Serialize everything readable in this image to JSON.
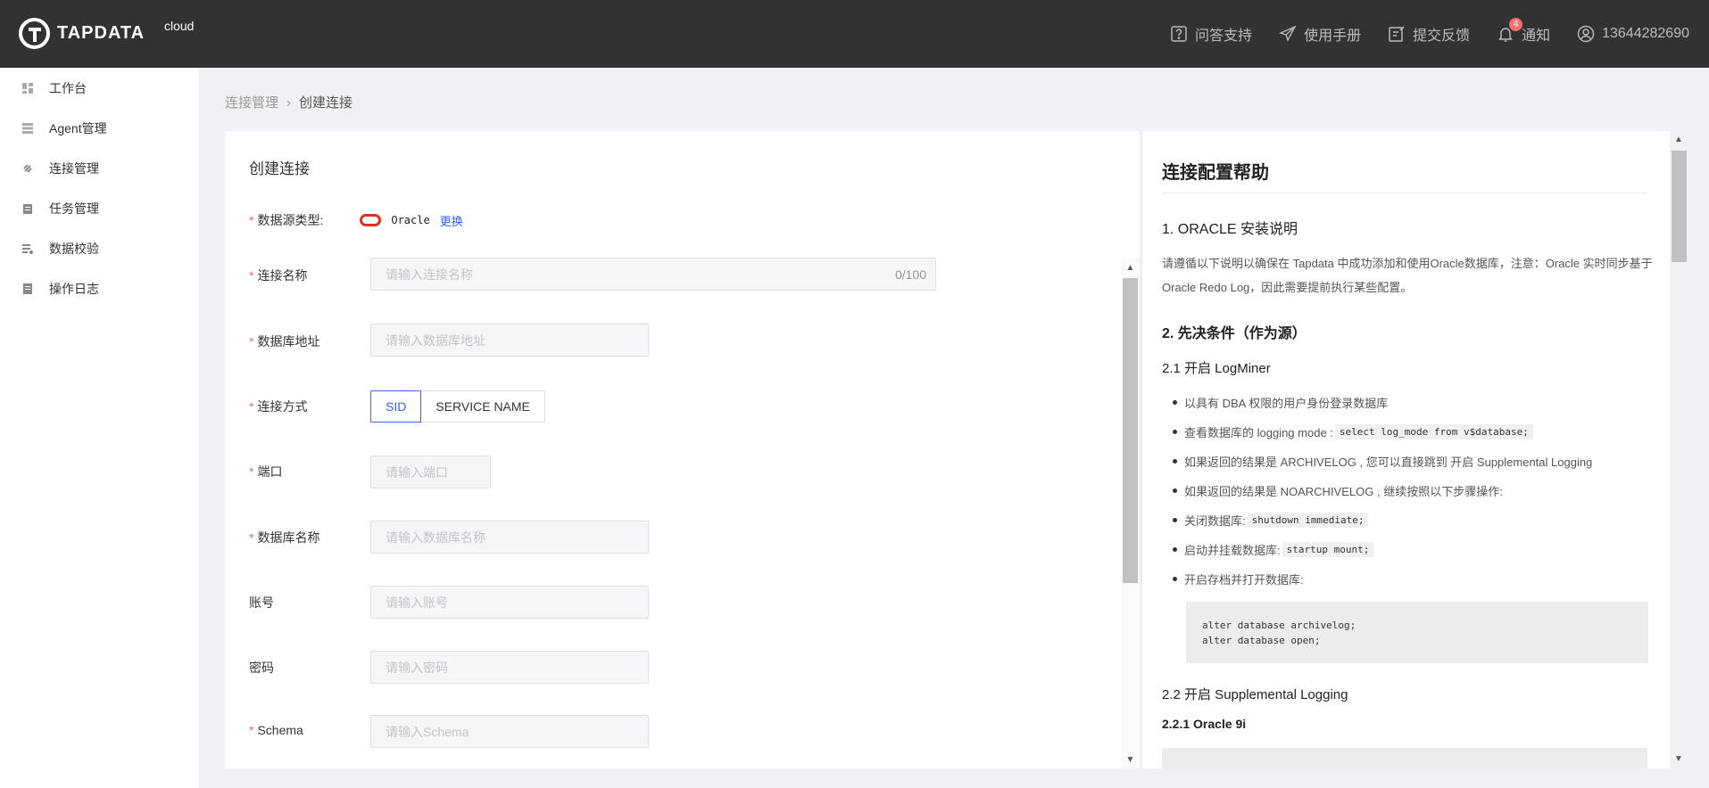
{
  "header": {
    "brand": "TAPDATA",
    "brand_sub": "cloud",
    "nav": [
      {
        "label": "问答支持",
        "icon": "question-icon"
      },
      {
        "label": "使用手册",
        "icon": "paper-plane-icon"
      },
      {
        "label": "提交反馈",
        "icon": "edit-icon"
      },
      {
        "label": "通知",
        "icon": "bell-icon",
        "badge": "4"
      },
      {
        "label": "13644282690",
        "icon": "user-icon"
      }
    ]
  },
  "sidebar": {
    "items": [
      {
        "label": "工作台",
        "icon": "dashboard-icon"
      },
      {
        "label": "Agent管理",
        "icon": "list-icon"
      },
      {
        "label": "连接管理",
        "icon": "link-icon"
      },
      {
        "label": "任务管理",
        "icon": "clipboard-icon"
      },
      {
        "label": "数据校验",
        "icon": "check-data-icon"
      },
      {
        "label": "操作日志",
        "icon": "log-icon"
      }
    ]
  },
  "breadcrumb": {
    "parent": "连接管理",
    "current": "创建连接"
  },
  "form": {
    "title": "创建连接",
    "datasource": {
      "label": "数据源类型:",
      "value": "Oracle",
      "change": "更换"
    },
    "fields": {
      "name": {
        "label": "连接名称",
        "placeholder": "请输入连接名称",
        "counter": "0/100"
      },
      "host": {
        "label": "数据库地址",
        "placeholder": "请输入数据库地址"
      },
      "mode": {
        "label": "连接方式",
        "options": [
          "SID",
          "SERVICE NAME"
        ],
        "selected": "SID"
      },
      "port": {
        "label": "端口",
        "placeholder": "请输入端口"
      },
      "dbname": {
        "label": "数据库名称",
        "placeholder": "请输入数据库名称"
      },
      "account": {
        "label": "账号",
        "placeholder": "请输入账号"
      },
      "password": {
        "label": "密码",
        "placeholder": "请输入密码"
      },
      "schema": {
        "label": "Schema",
        "placeholder": "请输入Schema"
      }
    }
  },
  "help": {
    "title": "连接配置帮助",
    "s1": "1. ORACLE 安装说明",
    "s1_text": "请遵循以下说明以确保在 Tapdata 中成功添加和使用Oracle数据库，注意：Oracle 实时同步基于Oracle Redo Log，因此需要提前执行某些配置。",
    "s2": "2. 先决条件（作为源）",
    "s21": "2.1 开启 LogMiner",
    "bullets": [
      {
        "text": "以具有 DBA 权限的用户身份登录数据库",
        "code": ""
      },
      {
        "text": "查看数据库的 logging mode :",
        "code": "select log_mode from v$database;"
      },
      {
        "text": "如果返回的结果是 ARCHIVELOG , 您可以直接跳到 开启 Supplemental Logging",
        "code": ""
      },
      {
        "text": "如果返回的结果是 NOARCHIVELOG , 继续按照以下步骤操作:",
        "code": ""
      },
      {
        "text": "关闭数据库:",
        "code": "shutdown immediate;"
      },
      {
        "text": "启动并挂载数据库:",
        "code": "startup mount;"
      },
      {
        "text": "开启存档并打开数据库:",
        "code": ""
      }
    ],
    "codeblock": "alter database archivelog;\nalter database open;",
    "s22": "2.2 开启 Supplemental Logging",
    "s221": "2.2.1 Oracle 9i"
  },
  "colors": {
    "accent": "#2c65ff",
    "required": "#f56c6c",
    "topbar": "#323232",
    "oracle": "#e0301e"
  }
}
